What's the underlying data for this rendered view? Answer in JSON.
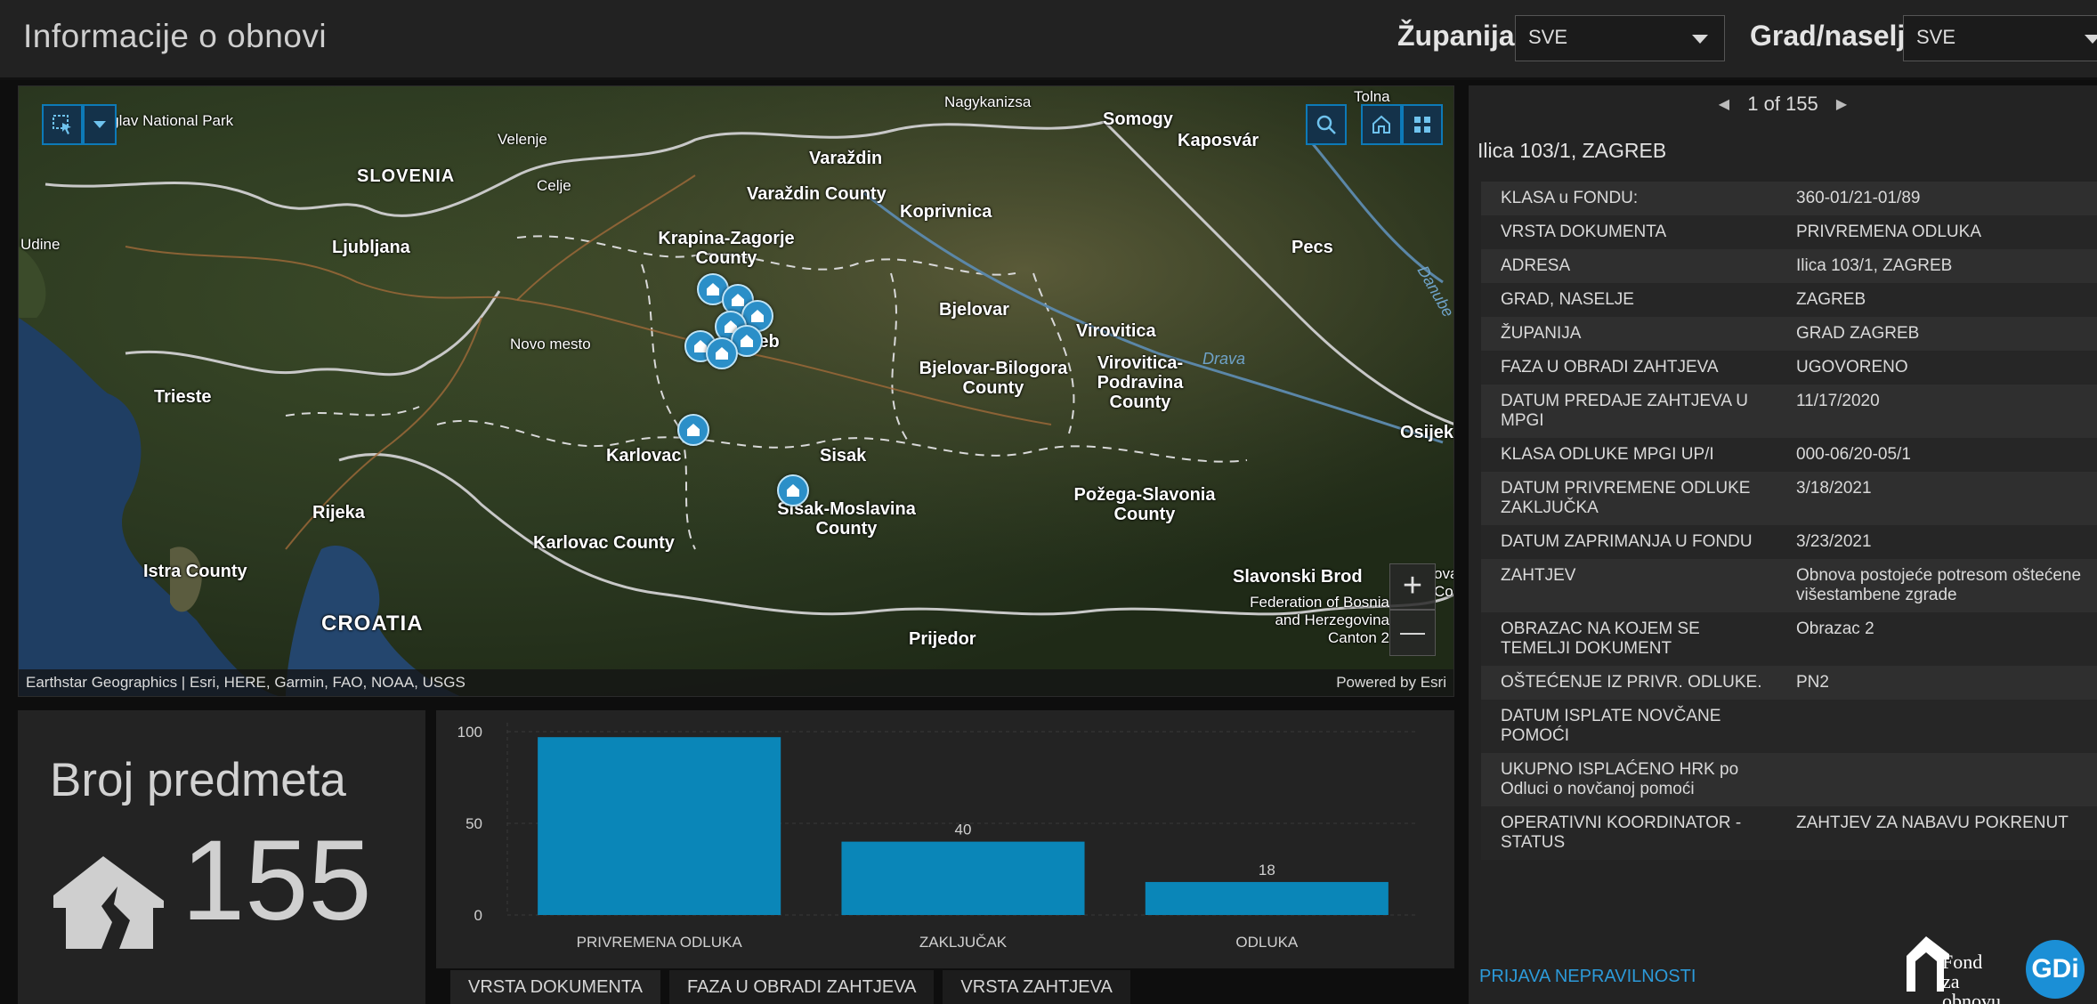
{
  "header": {
    "title": "Informacije o obnovi",
    "county_label": "Županija:",
    "county_value": "SVE",
    "city_label": "Grad/naselje:",
    "city_value": "SVE"
  },
  "map": {
    "attribution": "Earthstar Geographics | Esri, HERE, Garmin, FAO, NOAA, USGS",
    "powered_by": "Powered by Esri",
    "zoom_in": "+",
    "zoom_out": "—",
    "labels": {
      "triglav": "Triglav National Park",
      "slovenia": "SLOVENIA",
      "velenje": "Velenje",
      "celje": "Celje",
      "udine": "Udine",
      "ljubljana": "Ljubljana",
      "novo_mesto": "Novo mesto",
      "trieste": "Trieste",
      "rijeka": "Rijeka",
      "istra": "Istra County",
      "croatia": "CROATIA",
      "karlovac": "Karlovac",
      "karlovac_county": "Karlovac County",
      "nagykanizsa": "Nagykanizsa",
      "somogy": "Somogy",
      "kaposvar": "Kaposvár",
      "tolna": "Tolna",
      "varazdin": "Varaždin",
      "varazdin_county": "Varaždin County",
      "koprivnica": "Koprivnica",
      "krapina": "Krapina-Zagorje County",
      "zagreb": "Zagreb",
      "bjelovar": "Bjelovar",
      "bjelovar_county": "Bjelovar-Bilogora County",
      "virovitica": "Virovitica",
      "virovitica_county": "Virovitica-Podravina County",
      "pecs": "Pecs",
      "drava": "Drava",
      "danube": "Danube",
      "osijek": "Osijek",
      "sisak": "Sisak",
      "sisak_county": "Sisak-Moslavina County",
      "pozega": "Požega-Slavonia County",
      "slavonski_brod": "Slavonski Brod",
      "federation": "Federation of Bosnia and Herzegovina Canton 2",
      "prijedor": "Prijedor",
      "edge_ova": "ova",
      "edge_co": "Co"
    }
  },
  "details": {
    "pager_text": "1 of 155",
    "feature_title": "Ilica 103/1, ZAGREB",
    "rows": [
      {
        "k": "KLASA u FONDU:",
        "v": "360-01/21-01/89"
      },
      {
        "k": "VRSTA DOKUMENTA",
        "v": "PRIVREMENA ODLUKA"
      },
      {
        "k": "ADRESA",
        "v": "Ilica 103/1, ZAGREB"
      },
      {
        "k": "GRAD, NASELJE",
        "v": "ZAGREB"
      },
      {
        "k": "ŽUPANIJA",
        "v": "GRAD ZAGREB"
      },
      {
        "k": "FAZA U OBRADI ZAHTJEVA",
        "v": "UGOVORENO"
      },
      {
        "k": "DATUM PREDAJE ZAHTJEVA U MPGI",
        "v": "11/17/2020"
      },
      {
        "k": "KLASA ODLUKE MPGI UP/I",
        "v": "000-06/20-05/1"
      },
      {
        "k": "DATUM PRIVREMENE ODLUKE ZAKLJUČKA",
        "v": "3/18/2021"
      },
      {
        "k": "DATUM ZAPRIMANJA U FONDU",
        "v": "3/23/2021"
      },
      {
        "k": "ZAHTJEV",
        "v": "Obnova postojeće potresom oštećene višestambene zgrade"
      },
      {
        "k": "OBRAZAC NA KOJEM SE TEMELJI DOKUMENT",
        "v": "Obrazac 2"
      },
      {
        "k": "OŠTEĆENJE IZ PRIVR. ODLUKE.",
        "v": "PN2"
      },
      {
        "k": "DATUM ISPLATE NOVČANE POMOĆI",
        "v": ""
      },
      {
        "k": "UKUPNO ISPLAĆENO HRK po Odluci o novčanoj pomoći",
        "v": ""
      },
      {
        "k": "OPERATIVNI KOORDINATOR - STATUS",
        "v": "ZAHTJEV ZA NABAVU POKRENUT"
      }
    ],
    "report_link": "PRIJAVA NEPRAVILNOSTI",
    "logo_fond_line1": "Fond za",
    "logo_fond_line2": "obnovu",
    "logo_gdi": "GDi"
  },
  "count": {
    "title": "Broj predmeta",
    "value": "155"
  },
  "chart_data": {
    "type": "bar",
    "categories": [
      "PRIVREMENA ODLUKA",
      "ZAKLJUČAK",
      "ODLUKA"
    ],
    "values": [
      97,
      40,
      18
    ],
    "data_labels": [
      "",
      "40",
      "18"
    ],
    "yticks": [
      0,
      50,
      100
    ],
    "ylim": [
      0,
      100
    ],
    "bar_color": "#0a86b8",
    "grid": true
  },
  "tabs": [
    "VRSTA DOKUMENTA",
    "FAZA U OBRADI ZAHTJEVA",
    "VRSTA ZAHTJEVA"
  ],
  "colors": {
    "accent": "#0a86b8",
    "link": "#2c9ad9",
    "panel": "#232323"
  }
}
